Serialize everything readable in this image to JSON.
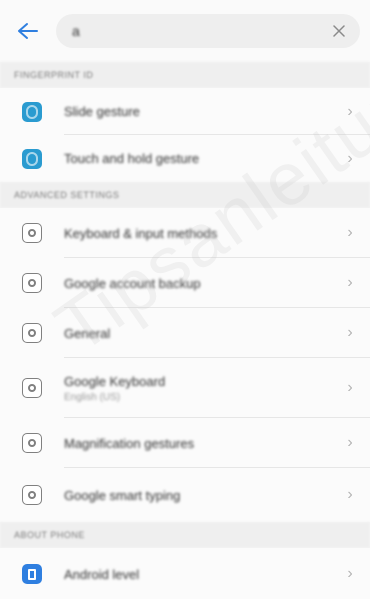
{
  "search": {
    "query": "a"
  },
  "sections": [
    {
      "header": "FINGERPRINT ID",
      "items": [
        {
          "title": "Slide gesture",
          "subtitle": "",
          "icon": "fingerprint-icon"
        },
        {
          "title": "Touch and hold gesture",
          "subtitle": "",
          "icon": "fingerprint-icon"
        }
      ]
    },
    {
      "header": "ADVANCED SETTINGS",
      "items": [
        {
          "title": "Keyboard & input methods",
          "subtitle": "",
          "icon": "settings-gear-icon"
        },
        {
          "title": "Google account backup",
          "subtitle": "",
          "icon": "settings-gear-icon"
        },
        {
          "title": "General",
          "subtitle": "",
          "icon": "settings-gear-icon"
        },
        {
          "title": "Google Keyboard",
          "subtitle": "English (US)",
          "icon": "settings-gear-icon"
        },
        {
          "title": "Magnification gestures",
          "subtitle": "",
          "icon": "settings-gear-icon"
        },
        {
          "title": "Google smart typing",
          "subtitle": "",
          "icon": "settings-gear-icon"
        }
      ]
    },
    {
      "header": "ABOUT PHONE",
      "items": [
        {
          "title": "Android level",
          "subtitle": "",
          "icon": "phone-info-icon"
        }
      ]
    }
  ],
  "watermark": "Tipsanleitung",
  "colors": {
    "accent": "#2f7fe0",
    "fingerprint": "#2a9bd0"
  }
}
